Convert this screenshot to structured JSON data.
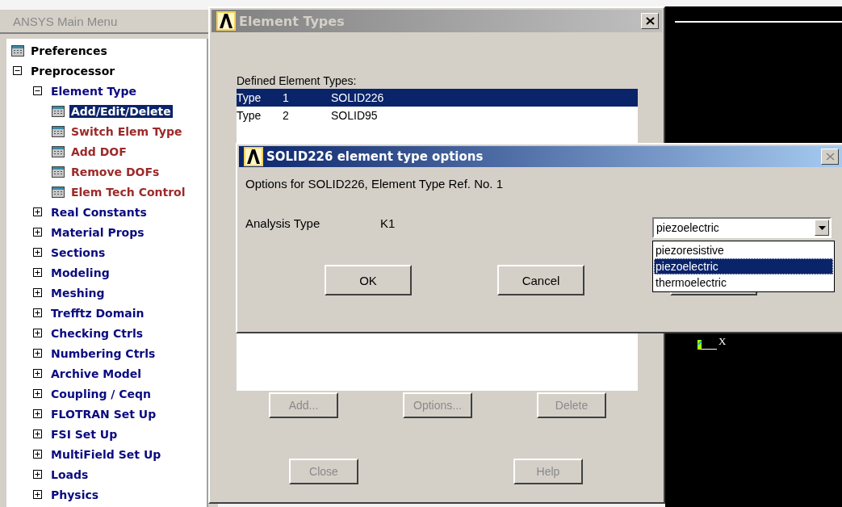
{
  "main_menu": {
    "title": "ANSYS Main Menu",
    "items": [
      {
        "label": "Preferences",
        "kind": "command",
        "selected": false
      },
      {
        "label": "Preprocessor",
        "kind": "folder",
        "expanded": true,
        "children": [
          {
            "label": "Element Type",
            "kind": "folder",
            "expanded": true,
            "children": [
              {
                "label": "Add/Edit/Delete",
                "kind": "command",
                "selected": true
              },
              {
                "label": "Switch Elem Type",
                "kind": "command",
                "selected": false
              },
              {
                "label": "Add DOF",
                "kind": "command",
                "selected": false
              },
              {
                "label": "Remove DOFs",
                "kind": "command",
                "selected": false
              },
              {
                "label": "Elem Tech Control",
                "kind": "command",
                "selected": false
              }
            ]
          },
          {
            "label": "Real Constants",
            "kind": "folder",
            "expanded": false
          },
          {
            "label": "Material Props",
            "kind": "folder",
            "expanded": false
          },
          {
            "label": "Sections",
            "kind": "folder",
            "expanded": false
          },
          {
            "label": "Modeling",
            "kind": "folder",
            "expanded": false
          },
          {
            "label": "Meshing",
            "kind": "folder",
            "expanded": false
          },
          {
            "label": "Trefftz Domain",
            "kind": "folder",
            "expanded": false
          },
          {
            "label": "Checking Ctrls",
            "kind": "folder",
            "expanded": false
          },
          {
            "label": "Numbering Ctrls",
            "kind": "folder",
            "expanded": false
          },
          {
            "label": "Archive Model",
            "kind": "folder",
            "expanded": false
          },
          {
            "label": "Coupling / Ceqn",
            "kind": "folder",
            "expanded": false
          },
          {
            "label": "FLOTRAN Set Up",
            "kind": "folder",
            "expanded": false
          },
          {
            "label": "FSI Set Up",
            "kind": "folder",
            "expanded": false
          },
          {
            "label": "MultiField Set Up",
            "kind": "folder",
            "expanded": false
          },
          {
            "label": "Loads",
            "kind": "folder",
            "expanded": false
          },
          {
            "label": "Physics",
            "kind": "folder",
            "expanded": false
          }
        ]
      }
    ]
  },
  "element_types": {
    "title": "Element Types",
    "list_label": "Defined Element Types:",
    "rows": [
      {
        "type": "Type",
        "number": "1",
        "name": "SOLID226",
        "selected": true
      },
      {
        "type": "Type",
        "number": "2",
        "name": "SOLID95",
        "selected": false
      }
    ],
    "buttons": [
      {
        "label": "Add...",
        "disabled": true
      },
      {
        "label": "Options...",
        "disabled": true
      },
      {
        "label": "Delete",
        "disabled": true
      }
    ],
    "footer_buttons": [
      {
        "label": "Close",
        "disabled": true
      },
      {
        "label": "Help",
        "disabled": true
      }
    ]
  },
  "options_dialog": {
    "title": "SOLID226 element type options",
    "description": "Options for SOLID226, Element Type Ref. No. 1",
    "field_label": "Analysis Type",
    "field_key": "K1",
    "combo_value": "piezoelectric",
    "dropdown_options": [
      {
        "label": "piezoresistive",
        "selected": false
      },
      {
        "label": "piezoelectric",
        "selected": true
      },
      {
        "label": "thermoelectric",
        "selected": false
      }
    ],
    "buttons": [
      {
        "label": "OK"
      },
      {
        "label": "Cancel"
      }
    ]
  },
  "graphics": {
    "axis_label": "X"
  }
}
